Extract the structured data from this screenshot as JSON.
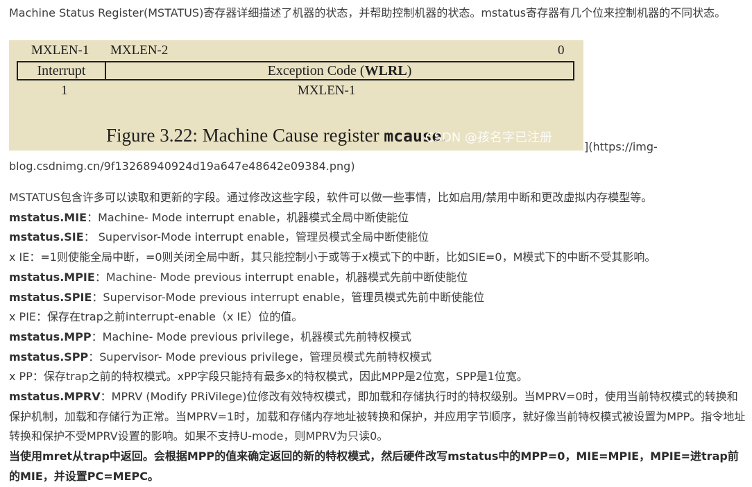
{
  "intro": "Machine Status Register(MSTATUS)寄存器详细描述了机器的状态，并帮助控制机器的状态。mstatus寄存器有几个位来控制机器的不同状态。",
  "figure": {
    "bit_high": "MXLEN-1",
    "bit_next": "MXLEN-2",
    "bit_low": "0",
    "field_interrupt": "Interrupt",
    "field_exception": "Exception Code (",
    "field_exception_bold": "WLRL",
    "field_exception_end": ")",
    "width_interrupt": "1",
    "width_exception": "MXLEN-1",
    "caption_prefix": "Figure 3.22: Machine Cause register ",
    "caption_code": "mcause",
    "caption_suffix": ".",
    "watermark": "CSDN @孩名字已注册"
  },
  "link_tail": "](https://img-",
  "link_line2": "blog.csdnimg.cn/9f13268940924d19a647e48642e09384.png)",
  "paragraphs": [
    {
      "bold": "",
      "text": "MSTATUS包含许多可以读取和更新的字段。通过修改这些字段，软件可以做一些事情，比如启用/禁用中断和更改虚拟内存模型等。"
    },
    {
      "bold": "mstatus.MIE",
      "text": "：Machine- Mode interrupt enable，机器模式全局中断使能位"
    },
    {
      "bold": "mstatus.SIE",
      "text": "： Supervisor-Mode interrupt enable，管理员模式全局中断使能位"
    },
    {
      "bold": "",
      "text": "x IE：=1则使能全局中断，=0则关闭全局中断，其只能控制小于或等于x模式下的中断，比如SIE=0，M模式下的中断不受其影响。"
    },
    {
      "bold": "mstatus.MPIE",
      "text": "：Machine- Mode previous interrupt enable，机器模式先前中断使能位"
    },
    {
      "bold": "mstatus.SPIE",
      "text": "：Supervisor-Mode previous interrupt enable，管理员模式先前中断使能位"
    },
    {
      "bold": "",
      "text": "x PIE：保存在trap之前interrupt-enable（x IE）位的值。"
    },
    {
      "bold": "mstatus.MPP",
      "text": "：Machine- Mode previous privilege，机器模式先前特权模式"
    },
    {
      "bold": "mstatus.SPP",
      "text": "：Supervisor- Mode previous privilege，管理员模式先前特权模式"
    },
    {
      "bold": "",
      "text": "x PP：保存trap之前的特权模式。xPP字段只能持有最多x的特权模式，因此MPP是2位宽，SPP是1位宽。"
    },
    {
      "bold": "mstatus.MPRV",
      "text": "：MPRV (Modify PRiVilege)位修改有效特权模式，即加载和存储执行时的特权级别。当MPRV=0时，使用当前特权模式的转换和保护机制，加载和存储行为正常。当MPRV=1时，加载和存储内存地址被转换和保护，并应用字节顺序，就好像当前特权模式被设置为MPP。指令地址转换和保护不受MPRV设置的影响。如果不支持U-mode，则MPRV为只读0。"
    }
  ],
  "closing": "当使用mret从trap中返回。会根据MPP的值来确定返回的新的特权模式，然后硬件改写mstatus中的MPP=0，MIE=MPIE，MPIE=进trap前的MIE，并设置PC=MEPC。"
}
